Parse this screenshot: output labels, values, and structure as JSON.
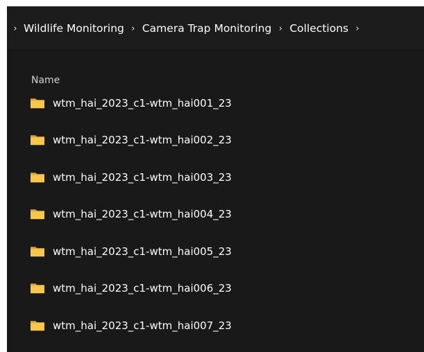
{
  "breadcrumb": {
    "items": [
      "Wildlife Monitoring",
      "Camera Trap Monitoring",
      "Collections"
    ],
    "separator": "›"
  },
  "file_list": {
    "column_header": "Name",
    "rows": [
      {
        "name": "wtm_hai_2023_c1-wtm_hai001_23",
        "icon": "folder-icon"
      },
      {
        "name": "wtm_hai_2023_c1-wtm_hai002_23",
        "icon": "folder-icon"
      },
      {
        "name": "wtm_hai_2023_c1-wtm_hai003_23",
        "icon": "folder-icon"
      },
      {
        "name": "wtm_hai_2023_c1-wtm_hai004_23",
        "icon": "folder-icon"
      },
      {
        "name": "wtm_hai_2023_c1-wtm_hai005_23",
        "icon": "folder-icon"
      },
      {
        "name": "wtm_hai_2023_c1-wtm_hai006_23",
        "icon": "folder-icon"
      },
      {
        "name": "wtm_hai_2023_c1-wtm_hai007_23",
        "icon": "folder-icon"
      }
    ]
  },
  "colors": {
    "window_background": "#191919",
    "address_bar_background": "#1c1c1c",
    "text": "#ffffff",
    "header_text": "#d2d2d2",
    "folder_back": "#d9a63a",
    "folder_front": "#f6c64d"
  }
}
